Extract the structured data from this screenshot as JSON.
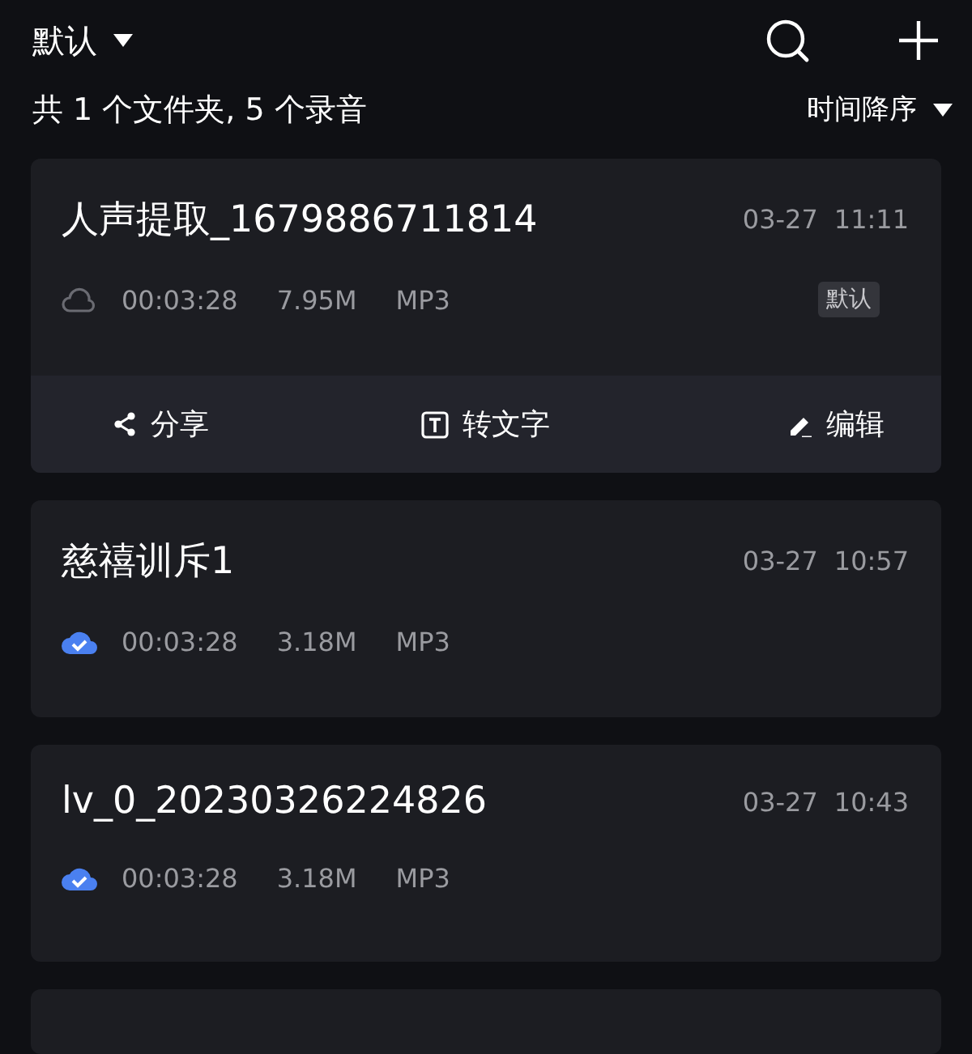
{
  "header": {
    "folder": "默认",
    "sort": "时间降序",
    "summary": "共 1 个文件夹, 5 个录音"
  },
  "recordings": [
    {
      "name": "人声提取_1679886711814",
      "date": "03-27",
      "time": "11:11",
      "duration": "00:03:28",
      "size": "7.95M",
      "format": "MP3",
      "synced": false,
      "tag": "默认",
      "expanded": true,
      "actions": [
        {
          "kind": "share",
          "label": "分享"
        },
        {
          "kind": "transcribe",
          "label": "转文字"
        },
        {
          "kind": "edit",
          "label": "编辑"
        }
      ]
    },
    {
      "name": "慈禧训斥1",
      "date": "03-27",
      "time": "10:57",
      "duration": "00:03:28",
      "size": "3.18M",
      "format": "MP3",
      "synced": true,
      "expanded": false
    },
    {
      "name": "lv_0_20230326224826",
      "date": "03-27",
      "time": "10:43",
      "duration": "00:03:28",
      "size": "3.18M",
      "format": "MP3",
      "synced": true,
      "expanded": false
    }
  ],
  "more_below": true
}
